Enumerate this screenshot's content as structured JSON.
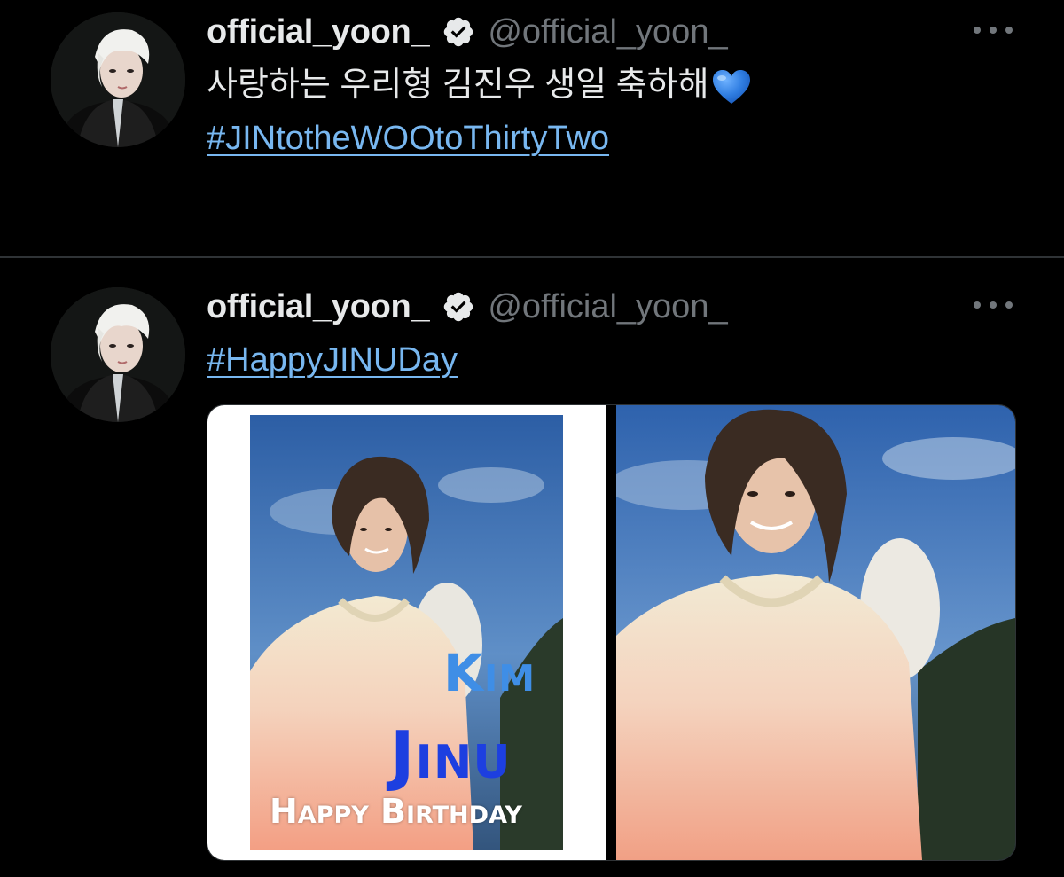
{
  "tweets": [
    {
      "display_name": "official_yoon_",
      "handle": "@official_yoon_",
      "text": "사랑하는 우리형 김진우 생일 축하해",
      "emoji": "blue-heart-icon",
      "hashtag": "#JINtotheWOOtoThirtyTwo"
    },
    {
      "display_name": "official_yoon_",
      "handle": "@official_yoon_",
      "hashtag": "#HappyJINUDay",
      "media": {
        "card": {
          "name_top": "Kim",
          "name_main": "Jinu",
          "greeting": "Happy Birthday"
        }
      }
    }
  ],
  "colors": {
    "background": "#000000",
    "divider": "#2f3336",
    "name": "#e7e9ea",
    "handle": "#71767b",
    "hashtag": "#78b7f0",
    "verified_badge": "#e7e9ea",
    "heart": "#2f7de1",
    "card_kim": "#3f8ee6",
    "card_jinu": "#1d3fe0"
  }
}
